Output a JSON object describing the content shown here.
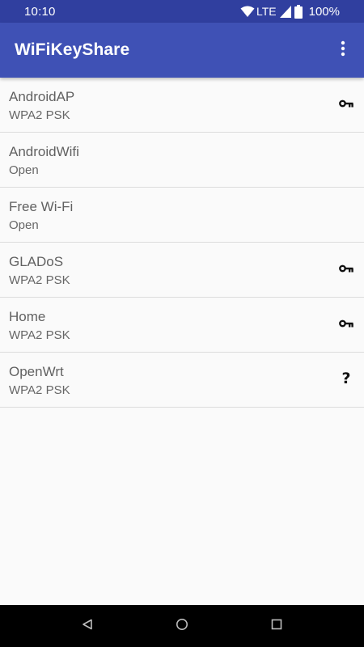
{
  "status_bar": {
    "time": "10:10",
    "network": "LTE",
    "battery": "100%",
    "icons": [
      "wifi-icon",
      "signal-icon",
      "battery-icon"
    ]
  },
  "app_bar": {
    "title": "WiFiKeyShare",
    "menu_icon": "overflow-menu-icon",
    "color": "#3f51b5",
    "status_color": "#303f9f"
  },
  "networks": [
    {
      "name": "AndroidAP",
      "security": "WPA2 PSK",
      "icon": "key-icon"
    },
    {
      "name": "AndroidWifi",
      "security": "Open",
      "icon": ""
    },
    {
      "name": "Free Wi-Fi",
      "security": "Open",
      "icon": ""
    },
    {
      "name": "GLADoS",
      "security": "WPA2 PSK",
      "icon": "key-icon"
    },
    {
      "name": "Home",
      "security": "WPA2 PSK",
      "icon": "key-icon"
    },
    {
      "name": "OpenWrt",
      "security": "WPA2 PSK",
      "icon": "question-icon",
      "icon_text": "?"
    }
  ],
  "nav_bar": {
    "icons": [
      "back-icon",
      "home-icon",
      "recents-icon"
    ]
  }
}
